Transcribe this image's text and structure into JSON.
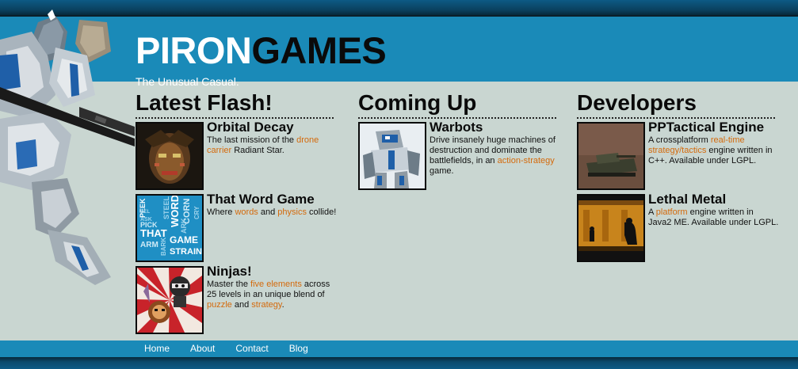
{
  "header": {
    "logo_part1": "PIRON",
    "logo_part2": "GAMES",
    "tagline": "The Unusual Casual."
  },
  "columns": [
    {
      "title": "Latest Flash!",
      "items": [
        {
          "title": "Orbital Decay",
          "desc": [
            {
              "t": "The last mission of the "
            },
            {
              "t": "drone carrier",
              "link": true
            },
            {
              "t": " Radiant Star."
            }
          ]
        },
        {
          "title": "That Word Game",
          "desc": [
            {
              "t": "Where "
            },
            {
              "t": "words",
              "link": true
            },
            {
              "t": " and "
            },
            {
              "t": "physics",
              "link": true
            },
            {
              "t": " collide!"
            }
          ]
        },
        {
          "title": "Ninjas!",
          "desc": [
            {
              "t": "Master the "
            },
            {
              "t": "five elements",
              "link": true
            },
            {
              "t": " across 25 levels in an unique blend of "
            },
            {
              "t": "puzzle",
              "link": true
            },
            {
              "t": " and "
            },
            {
              "t": "strategy",
              "link": true
            },
            {
              "t": "."
            }
          ]
        }
      ]
    },
    {
      "title": "Coming Up",
      "items": [
        {
          "title": "Warbots",
          "desc": [
            {
              "t": "Drive insanely huge machines of destruction and dominate the battlefields, in an "
            },
            {
              "t": "action-strategy",
              "link": true
            },
            {
              "t": " game."
            }
          ]
        }
      ]
    },
    {
      "title": "Developers",
      "items": [
        {
          "title": "PPTactical Engine",
          "desc": [
            {
              "t": "A crossplatform "
            },
            {
              "t": "real-time strategy/tactics",
              "link": true
            },
            {
              "t": " engine written in C++. Available under LGPL."
            }
          ]
        },
        {
          "title": "Lethal Metal",
          "desc": [
            {
              "t": "A "
            },
            {
              "t": "platform",
              "link": true
            },
            {
              "t": " engine written in Java2 ME. Available under LGPL."
            }
          ]
        }
      ]
    }
  ],
  "thumbs": {
    "word_game_words": [
      "PEEK",
      "STEEL",
      "WORD",
      "CORN",
      "ARK",
      "CRY",
      "THAT",
      "GAME",
      "ARM",
      "BARK",
      "STRAIN",
      "PICK",
      "ASK",
      "GEL"
    ]
  },
  "nav": [
    "Home",
    "About",
    "Contact",
    "Blog"
  ],
  "colors": {
    "accent": "#1a8ab8",
    "link": "#d46a0c",
    "background": "#c9d6d1"
  }
}
